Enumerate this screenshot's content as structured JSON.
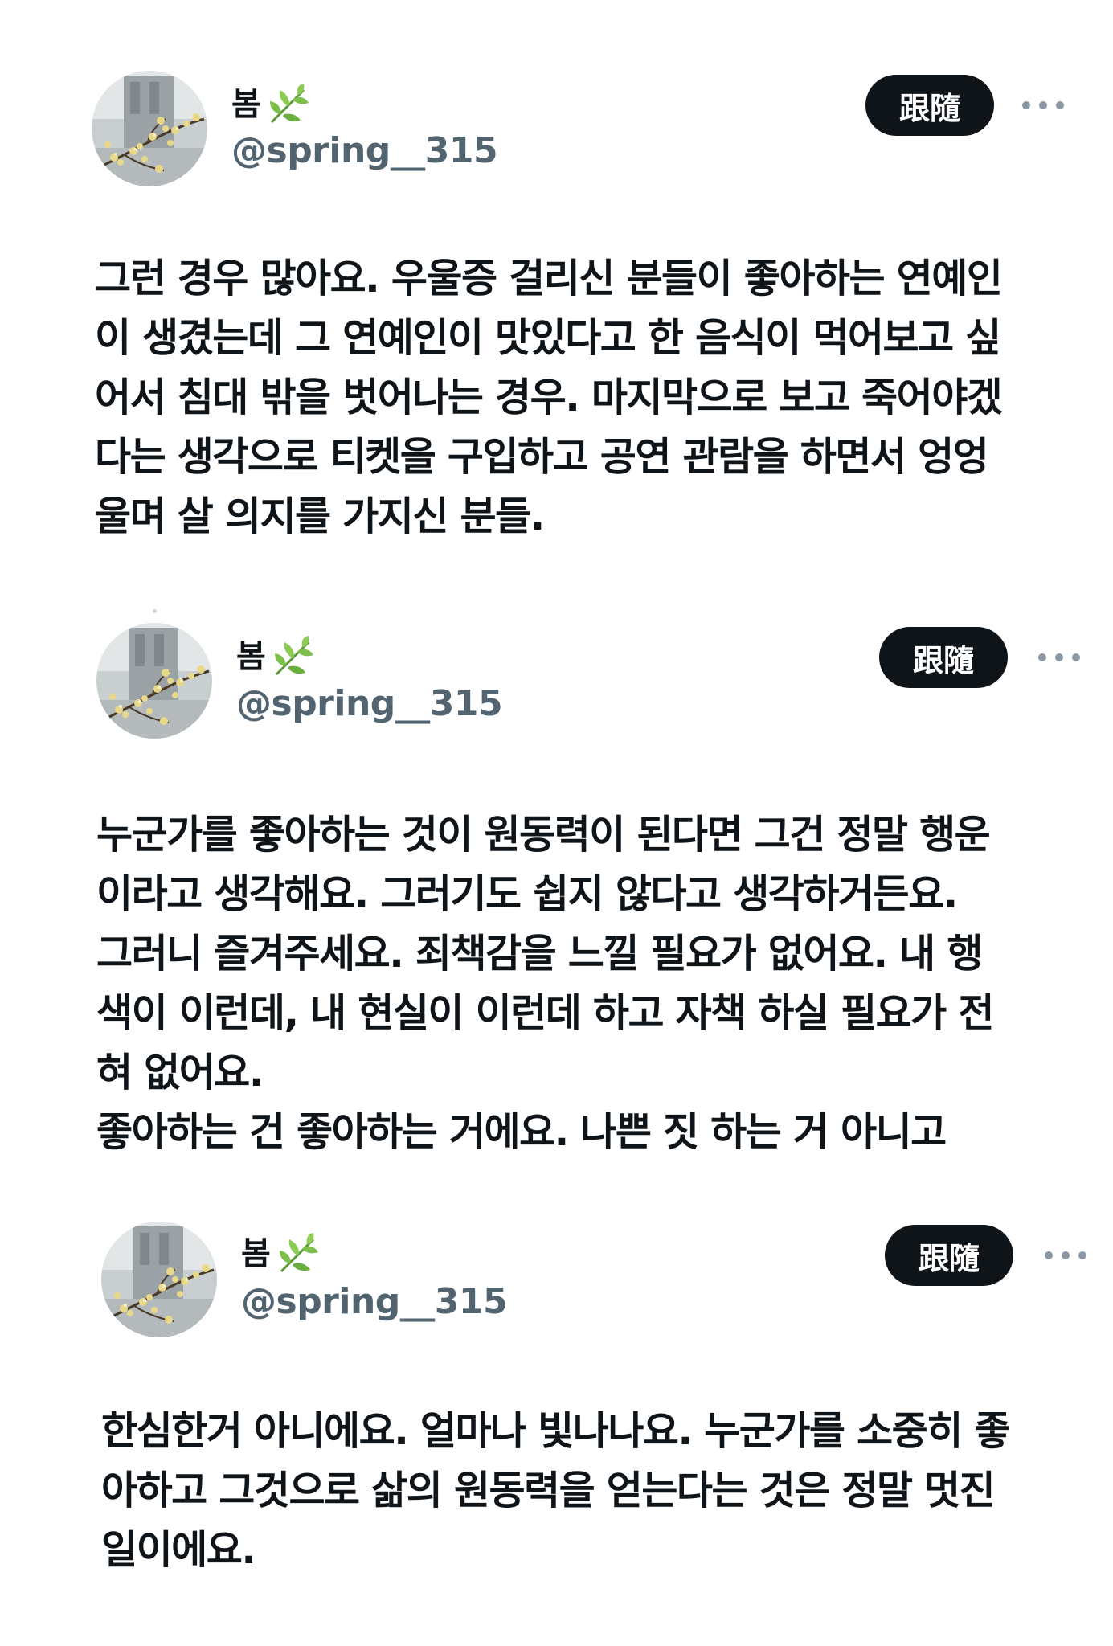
{
  "posts": [
    {
      "display_name": "봄",
      "name_icon": "herb-leaf-icon",
      "handle": "@spring__315",
      "follow_label": "跟隨",
      "more_icon": "more-horizontal-icon",
      "text": "그런 경우 많아요. 우울증 걸리신 분들이 좋아하는 연예인\n이 생겼는데 그 연예인이 맛있다고 한 음식이 먹어보고 싶\n어서 침대 밖을 벗어나는 경우. 마지막으로 보고 죽어야겠\n다는 생각으로 티켓을 구입하고 공연 관람을 하면서 엉엉\n울며 살 의지를 가지신 분들."
    },
    {
      "display_name": "봄",
      "name_icon": "herb-leaf-icon",
      "handle": "@spring__315",
      "follow_label": "跟隨",
      "more_icon": "more-horizontal-icon",
      "text": "누군가를 좋아하는 것이 원동력이 된다면 그건 정말 행운\n이라고 생각해요. 그러기도 쉽지 않다고 생각하거든요.\n그러니 즐겨주세요. 죄책감을 느낄 필요가 없어요. 내 행\n색이 이런데, 내 현실이 이런데 하고 자책 하실 필요가 전\n혀 없어요.\n좋아하는 건 좋아하는 거에요. 나쁜 짓 하는 거 아니고"
    },
    {
      "display_name": "봄",
      "name_icon": "herb-leaf-icon",
      "handle": "@spring__315",
      "follow_label": "跟隨",
      "more_icon": "more-horizontal-icon",
      "text": "한심한거 아니에요. 얼마나 빛나나요. 누군가를 소중히 좋\n아하고 그것으로 삶의 원동력을 얻는다는 것은 정말 멋진\n일이에요."
    }
  ],
  "colors": {
    "text": "#0f1419",
    "handle": "#536471",
    "follow_bg": "#0f1419",
    "follow_text": "#ffffff",
    "more_dots": "#8b98a5"
  }
}
